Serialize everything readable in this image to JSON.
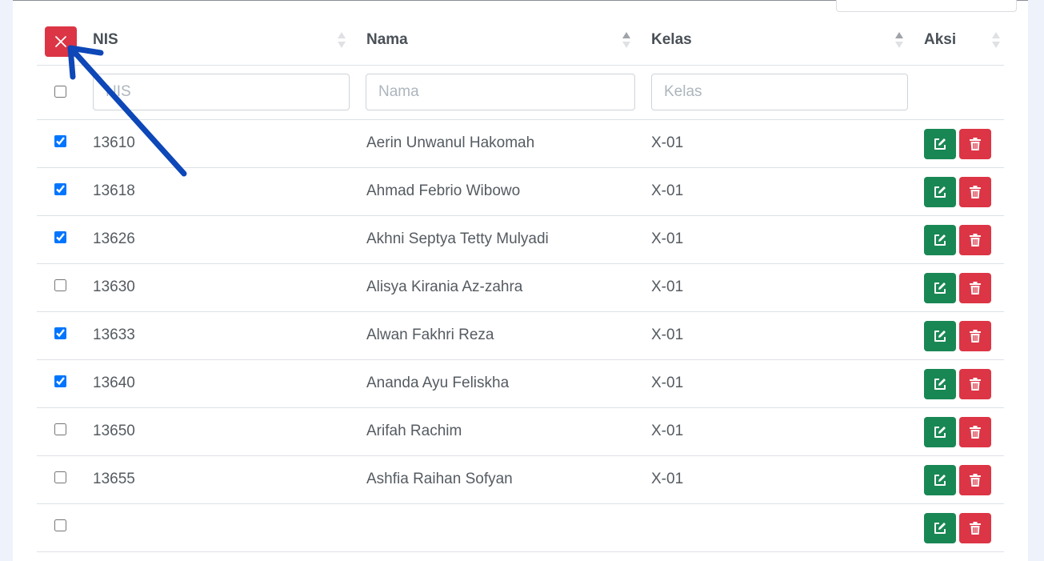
{
  "table": {
    "headers": {
      "nis": "NIS",
      "nama": "Nama",
      "kelas": "Kelas",
      "aksi": "Aksi"
    },
    "filters": {
      "nis_placeholder": "NIS",
      "nama_placeholder": "Nama",
      "kelas_placeholder": "Kelas"
    },
    "rows": [
      {
        "checked": true,
        "nis": "13610",
        "nama": "Aerin Unwanul Hakomah",
        "kelas": "X-01"
      },
      {
        "checked": true,
        "nis": "13618",
        "nama": "Ahmad Febrio Wibowo",
        "kelas": "X-01"
      },
      {
        "checked": true,
        "nis": "13626",
        "nama": "Akhni Septya Tetty Mulyadi",
        "kelas": "X-01"
      },
      {
        "checked": false,
        "nis": "13630",
        "nama": "Alisya Kirania Az-zahra",
        "kelas": "X-01"
      },
      {
        "checked": true,
        "nis": "13633",
        "nama": "Alwan Fakhri Reza",
        "kelas": "X-01"
      },
      {
        "checked": true,
        "nis": "13640",
        "nama": "Ananda Ayu Feliskha",
        "kelas": "X-01"
      },
      {
        "checked": false,
        "nis": "13650",
        "nama": "Arifah Rachim",
        "kelas": "X-01"
      },
      {
        "checked": false,
        "nis": "13655",
        "nama": "Ashfia Raihan Sofyan",
        "kelas": "X-01"
      },
      {
        "checked": false,
        "nis": "",
        "nama": "",
        "kelas": ""
      }
    ]
  },
  "icons": {
    "clear_selection": "close-icon",
    "edit": "edit-icon",
    "delete": "trash-icon"
  },
  "colors": {
    "danger": "#dc3545",
    "success": "#198754",
    "annotation_arrow": "#0d47b8",
    "checkbox_checked": "#0d6efd"
  }
}
